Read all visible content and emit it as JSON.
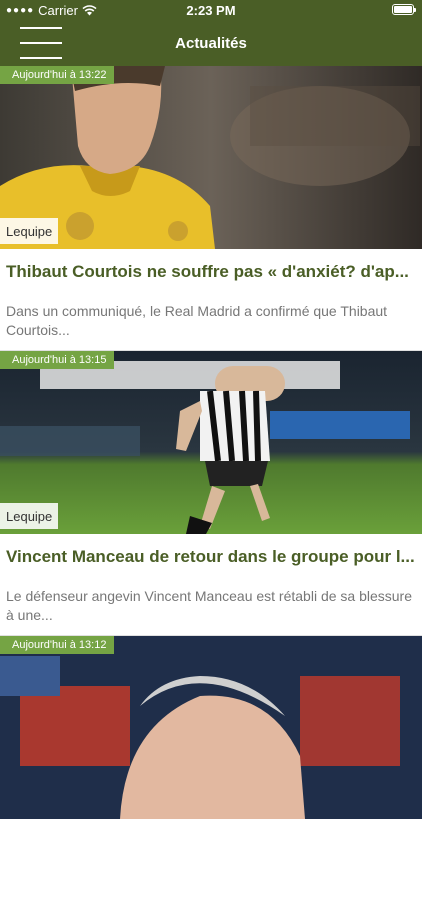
{
  "status_bar": {
    "carrier": "Carrier",
    "time": "2:23 PM"
  },
  "nav": {
    "title": "Actualités"
  },
  "articles": [
    {
      "time": "Aujourd'hui à 13:22",
      "source": "Lequipe",
      "title": "Thibaut Courtois ne souffre pas « d'anxiét? d'ap...",
      "summary": "Dans un communiqué, le Real Madrid a confirmé que Thibaut Courtois..."
    },
    {
      "time": "Aujourd'hui à 13:15",
      "source": "Lequipe",
      "title": "Vincent Manceau de retour dans le groupe pour l...",
      "summary": "Le défenseur angevin Vincent Manceau est rétabli de sa blessure à une..."
    },
    {
      "time": "Aujourd'hui à 13:12"
    }
  ],
  "colors": {
    "header": "#4a5e26",
    "badge": "#75a444",
    "title": "#4a5e26"
  }
}
